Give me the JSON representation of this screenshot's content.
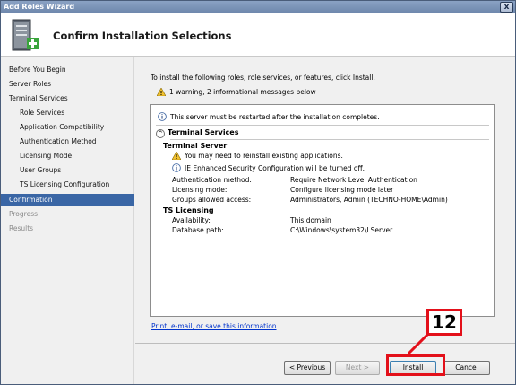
{
  "window": {
    "title": "Add Roles Wizard",
    "close_glyph": "x"
  },
  "header": {
    "title": "Confirm Installation Selections",
    "icon": "server-add-icon"
  },
  "sidebar": {
    "items": [
      {
        "label": "Before You Begin"
      },
      {
        "label": "Server Roles"
      },
      {
        "label": "Terminal Services"
      },
      {
        "label": "Role Services"
      },
      {
        "label": "Application Compatibility"
      },
      {
        "label": "Authentication Method"
      },
      {
        "label": "Licensing Mode"
      },
      {
        "label": "User Groups"
      },
      {
        "label": "TS Licensing Configuration"
      },
      {
        "label": "Confirmation"
      },
      {
        "label": "Progress"
      },
      {
        "label": "Results"
      }
    ],
    "active": "Confirmation"
  },
  "main": {
    "intro": "To install the following roles, role services, or features, click Install.",
    "summary": "1 warning, 2 informational messages below",
    "restart_notice": "This server must be restarted after the installation completes.",
    "section": "Terminal Services",
    "ts_heading": "Terminal Server",
    "warning_reinstall": "You may need to reinstall existing applications.",
    "ie_notice": "IE Enhanced Security Configuration will be turned off.",
    "details": [
      {
        "key": "Authentication method:",
        "value": "Require Network Level Authentication"
      },
      {
        "key": "Licensing mode:",
        "value": "Configure licensing mode later"
      },
      {
        "key": "Groups allowed access:",
        "value": "Administrators, Admin (TECHNO-HOME\\Admin)"
      }
    ],
    "licensing_heading": "TS Licensing",
    "licensing": [
      {
        "key": "Availability:",
        "value": "This domain"
      },
      {
        "key": "Database path:",
        "value": "C:\\Windows\\system32\\LServer"
      }
    ],
    "print_link": "Print, e-mail, or save this information"
  },
  "buttons": {
    "previous": "< Previous",
    "next": "Next >",
    "install": "Install",
    "cancel": "Cancel"
  },
  "annotation": {
    "step_number": "12",
    "color": "#e3101a"
  }
}
